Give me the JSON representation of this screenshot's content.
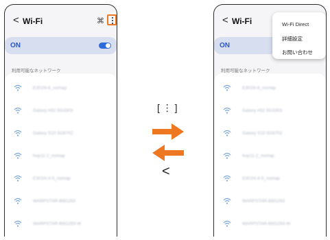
{
  "left_screen": {
    "title": "Wi-Fi",
    "back_glyph": "<",
    "scan_glyph": "⌘",
    "toggle_label": "ON",
    "section_label": "利用可能なネットワーク",
    "networks": [
      "E301N-6_nomap",
      "Galaxy A52 5G3303",
      "Galaxy S10 5G6702",
      "hop11-2_nomap",
      "E301N-4-5_nomap",
      "WARPSTAR-B6G293",
      "WARPSTAR-B6G293-W"
    ]
  },
  "right_screen": {
    "title": "Wi-Fi",
    "back_glyph": "<",
    "toggle_label": "ON",
    "section_label": "利用可能なネットワーク",
    "networks": [
      "E301N-6_nomap",
      "Galaxy A52 5G3303",
      "Galaxy S10 5G6702",
      "hop11-2_nomap",
      "E301N-4-5_nomap",
      "WARPSTAR-B6G293",
      "WARPSTAR-B6G293-W"
    ],
    "menu_items": [
      "Wi-Fi Direct",
      "詳細設定",
      "お問い合わせ"
    ]
  },
  "middle": {
    "key_label": "[ ⋮ ]",
    "back_label": "<"
  },
  "colors": {
    "accent_orange": "#ee7722",
    "toggle_blue": "#2f6bdb",
    "on_card": "#d6def0",
    "wifi_icon": "#7aa7d9"
  },
  "icons": {
    "wifi": "wifi-icon",
    "menu": "more-vertical-icon",
    "scan": "qr-scan-icon",
    "back": "chevron-left-icon"
  }
}
